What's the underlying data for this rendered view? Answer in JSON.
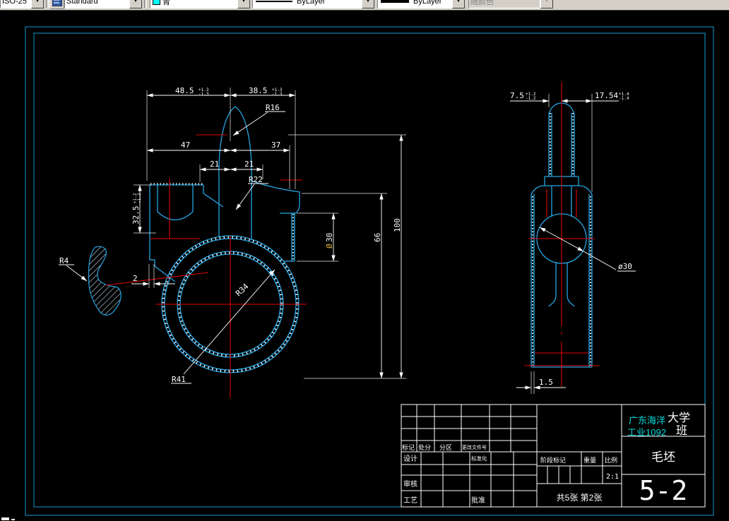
{
  "toolbar": {
    "dim_style_value": "ISO-25",
    "text_style_value": "Standard",
    "color_value": "青",
    "color_swatch": "#00ffff",
    "linetype_value": "ByLayer",
    "lineweight_value": "ByLayer",
    "plot_style_value": "随颜色"
  },
  "colors": {
    "frame": "#0e9cd0",
    "geometry": "#25a5e2",
    "centerline": "#e00000",
    "dimension": "#ffffff",
    "school_text": "#00dddd"
  },
  "front_view": {
    "dim_48_5": "48.5",
    "dim_48_5_tol_up": "+1.3",
    "dim_48_5_tol_dn": "-1.3",
    "dim_38_5": "38.5",
    "dim_38_5_tol_up": "+1.3",
    "dim_38_5_tol_dn": "-1.3",
    "dim_47": "47",
    "dim_37": "37",
    "dim_21_left": "21",
    "dim_21_right": "21",
    "radius_r16": "R16",
    "radius_r22": "R22",
    "radius_r41": "R41",
    "radius_r34": "R34",
    "radius_r4": "R4",
    "dim_32_5": "32.5",
    "dim_32_5_tol_up": "+1.2",
    "dim_32_5_tol_dn": "-1.2",
    "dim_2": "2",
    "dim_dia30_symbol": "Ø",
    "dim_dia30_value": "30",
    "dim_66": "66",
    "dim_100": "100"
  },
  "side_view": {
    "dim_7_5": "7.5",
    "dim_7_5_tol_up": "+1.2",
    "dim_7_5_tol_dn": "-1.2",
    "dim_17_54": "17.54",
    "dim_17_54_tol_up": "+1.4",
    "dim_17_54_tol_dn": "-1.4",
    "dim_dia30": "ø30",
    "dim_1_5": "1.5"
  },
  "title_block": {
    "school_line1_cyan": "广东海洋",
    "school_line1_white": "大学",
    "school_line2_cyan": "工业1092",
    "school_line2_white": "班",
    "part_name": "毛坯",
    "drawing_number": "5-2",
    "scale_value": "2:1",
    "sheet_info": "共5张 第2张",
    "label_mark": "标记",
    "label_count": "处分",
    "label_zone": "分区",
    "label_change_doc": "更改文件号",
    "label_design": "设计",
    "label_standardize": "标准化",
    "label_check": "审核",
    "label_process": "工艺",
    "label_approve": "批准",
    "label_stage_mark": "阶段标记",
    "label_weight": "重量",
    "label_scale": "比例"
  }
}
